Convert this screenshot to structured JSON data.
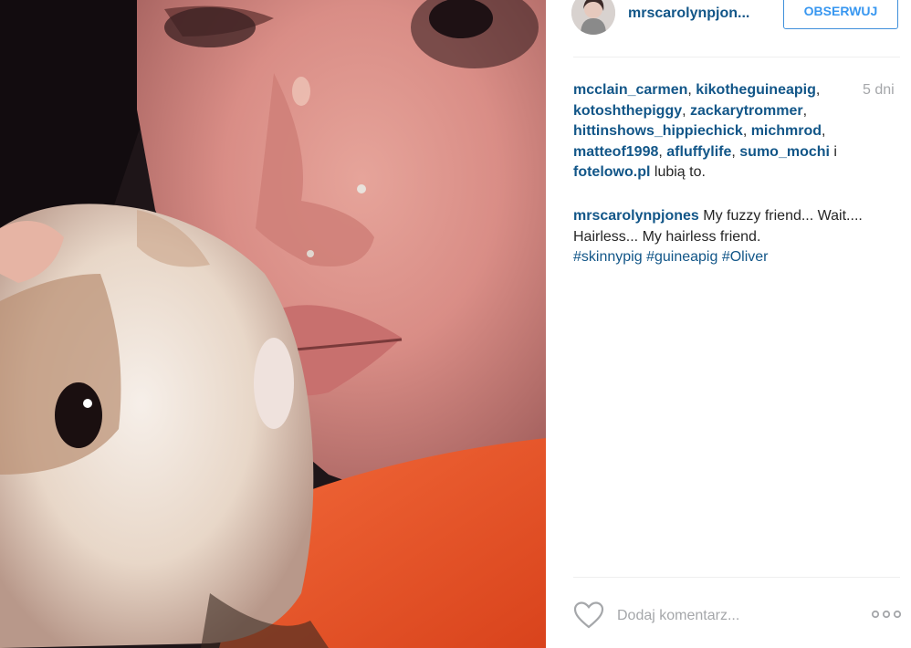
{
  "post": {
    "photo_alt": "",
    "author": {
      "username": "mrscarolynpjon...",
      "avatar_icon": "avatar-photo"
    },
    "follow_label": "OBSERWUJ",
    "time_ago": "5 dni",
    "likes": {
      "users": [
        "mcclain_carmen",
        "kikotheguineapig",
        "kotoshthepiggy",
        "zackarytrommer",
        "hittinshows_hippiechick",
        "michmrod",
        "matteof1998",
        "afluffylife",
        "sumo_mochi",
        "fotelowo.pl"
      ],
      "separator": ", ",
      "conjunction": " i ",
      "suffix": " lubią to."
    },
    "caption": {
      "username": "mrscarolynpjones",
      "text": " My fuzzy friend... Wait.... Hairless... My hairless friend.",
      "tags": [
        "#skinnypig",
        "#guineapig",
        "#Oliver"
      ]
    },
    "actions": {
      "like_icon": "heart-icon",
      "comment_placeholder": "Dodaj komentarz...",
      "more_icon": "ellipsis-icon"
    }
  },
  "colors": {
    "link": "#125688",
    "follow": "#3897f0",
    "muted": "#a5a7aa",
    "divider": "#efefef"
  }
}
